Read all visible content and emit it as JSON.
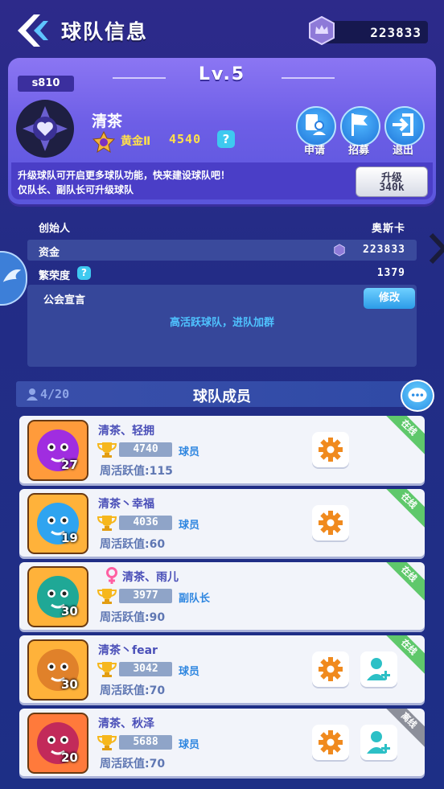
{
  "header": {
    "title": "球队信息",
    "currency_value": "223833"
  },
  "team": {
    "server_id": "s810",
    "level": "Lv.5",
    "name": "清茶",
    "rank_tier": "黄金Ⅱ",
    "rank_points": "4540",
    "help_mark": "?",
    "actions": [
      {
        "label": "申请",
        "icon": "apply-icon"
      },
      {
        "label": "招募",
        "icon": "flag-icon"
      },
      {
        "label": "退出",
        "icon": "exit-icon"
      }
    ],
    "notice_line1": "升级球队可开启更多球队功能，快来建设球队吧！",
    "notice_line2": "仅队长、副队长可升级球队",
    "upgrade_label": "升级",
    "upgrade_cost": "340k"
  },
  "info": {
    "founder_label": "创始人",
    "founder_value": "奥斯卡",
    "funds_label": "资金",
    "funds_value": "223833",
    "prosperity_label": "繁荣度",
    "prosperity_value": "1379",
    "declaration_label": "公会宣言",
    "edit_label": "修改",
    "declaration_text": "高活跃球队，进队加群"
  },
  "members_header": {
    "count": "4/20",
    "title": "球队成员"
  },
  "members": [
    {
      "name": "清茶、轻拥",
      "score": "4740",
      "role": "球员",
      "weekly": "周活跃值:115",
      "level": "27",
      "status": "在线",
      "online": true,
      "can_add": false,
      "female": false
    },
    {
      "name": "清茶丶幸福",
      "score": "4036",
      "role": "球员",
      "weekly": "周活跃值:60",
      "level": "19",
      "status": "在线",
      "online": true,
      "can_add": false,
      "female": false
    },
    {
      "name": "清茶、雨儿",
      "score": "3977",
      "role": "副队长",
      "weekly": "周活跃值:90",
      "level": "30",
      "status": "在线",
      "online": true,
      "can_add": false,
      "female": true
    },
    {
      "name": "清茶丶fear",
      "score": "3042",
      "role": "球员",
      "weekly": "周活跃值:70",
      "level": "30",
      "status": "在线",
      "online": true,
      "can_add": true,
      "female": false
    },
    {
      "name": "清茶、秋泽",
      "score": "5688",
      "role": "球员",
      "weekly": "周活跃值:70",
      "level": "20",
      "status": "离线",
      "online": false,
      "can_add": true,
      "female": false
    }
  ],
  "colors": {
    "accent": "#2e86e0",
    "online": "#5fc86b",
    "offline": "#8c8f9a",
    "gold": "#ffe04a"
  }
}
